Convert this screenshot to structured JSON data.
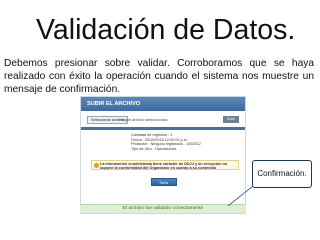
{
  "slide": {
    "title": "Validación de Datos.",
    "body": "Debemos presionar sobre validar. Corroboramos que se haya realizado con éxito la operación cuando el sistema nos muestre un mensaje de confirmación."
  },
  "screenshot": {
    "panel_title": "SUBIR EL ARCHIVO",
    "file_button_label": "Seleccionar archivo",
    "file_status": "Ningún archivo seleccionado",
    "upload_button_label": "Subir",
    "info_lines": [
      "Cantidad de registros : 1",
      "Fecha : 25/10/2015 12:00:00 p.m.",
      "Productor : Ninguno registrado - 1002012",
      "Tipo de Giro : Operaciones"
    ],
    "notice_lines": [
      "La información suministrada tiene carácter de DDJJ y su recepción no",
      "supone la conformidad del Organismo en cuanto a su contenido"
    ],
    "submit_label": "Subir",
    "success_message": "El archivo fue validado correctamente"
  },
  "callout": {
    "label": "Confirmación."
  },
  "colors": {
    "panel_header": "#4a76a8",
    "success_background": "#dcefd3",
    "success_text": "#3c6e2c",
    "submit_button": "#3a73b4",
    "callout_border": "#1d3557"
  }
}
